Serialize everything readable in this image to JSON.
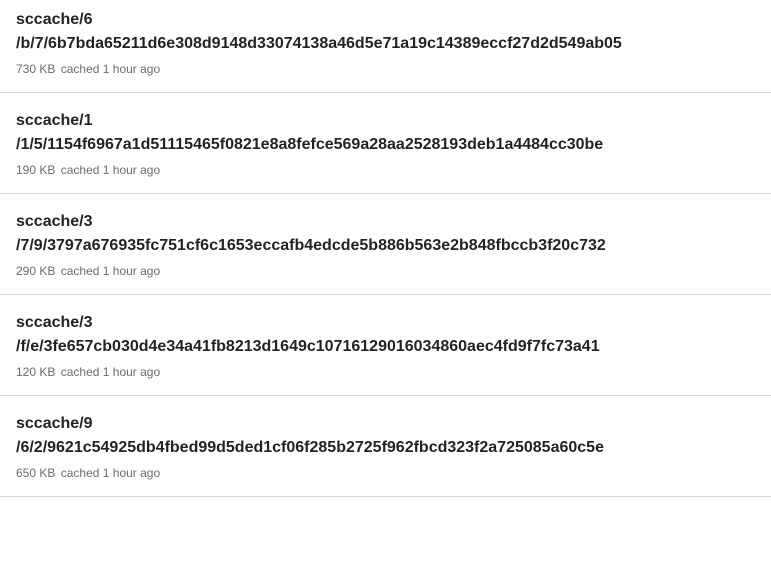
{
  "caches": [
    {
      "title_line1": "sccache/6",
      "title_line2": "/b/7/6b7bda65211d6e308d9148d33074138a46d5e71a19c14389eccf27d2d549ab05",
      "size": "730 KB",
      "cached_text": "cached",
      "time_ago": "1 hour ago"
    },
    {
      "title_line1": "sccache/1",
      "title_line2": "/1/5/1154f6967a1d51115465f0821e8a8fefce569a28aa2528193deb1a4484cc30be",
      "size": "190 KB",
      "cached_text": "cached",
      "time_ago": "1 hour ago"
    },
    {
      "title_line1": "sccache/3",
      "title_line2": "/7/9/3797a676935fc751cf6c1653eccafb4edcde5b886b563e2b848fbccb3f20c732",
      "size": "290 KB",
      "cached_text": "cached",
      "time_ago": "1 hour ago"
    },
    {
      "title_line1": "sccache/3",
      "title_line2": "/f/e/3fe657cb030d4e34a41fb8213d1649c10716129016034860aec4fd9f7fc73a41",
      "size": "120 KB",
      "cached_text": "cached",
      "time_ago": "1 hour ago"
    },
    {
      "title_line1": "sccache/9",
      "title_line2": "/6/2/9621c54925db4fbed99d5ded1cf06f285b2725f962fbcd323f2a725085a60c5e",
      "size": "650 KB",
      "cached_text": "cached",
      "time_ago": "1 hour ago"
    }
  ]
}
